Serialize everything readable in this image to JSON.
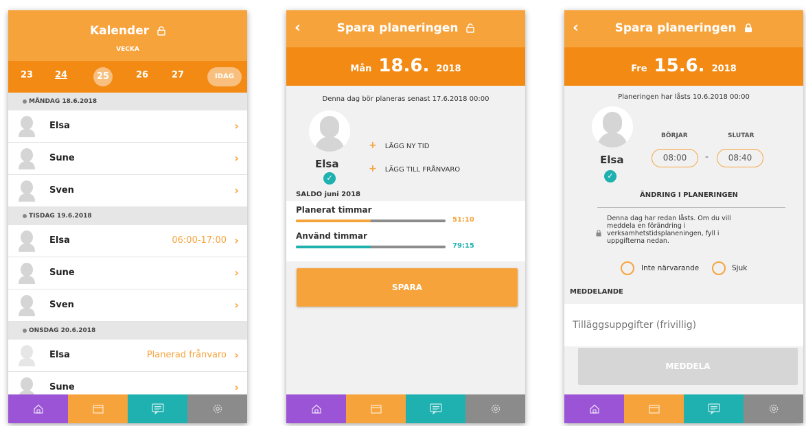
{
  "colors": {
    "accent": "#f7a33c",
    "accent_dark": "#f28a14",
    "teal": "#1fb1b0",
    "purple": "#9c54d6",
    "grey": "#8b8b8b"
  },
  "calendar": {
    "title": "Kalender",
    "subtitle": "VECKA",
    "weeks": [
      "23",
      "24",
      "25",
      "26",
      "27"
    ],
    "today_label": "IDAG",
    "days": [
      {
        "header": "MÅNDAG 18.6.2018",
        "rows": [
          {
            "name": "Elsa",
            "time": ""
          },
          {
            "name": "Sune",
            "time": ""
          },
          {
            "name": "Sven",
            "time": ""
          }
        ]
      },
      {
        "header": "TISDAG 19.6.2018",
        "rows": [
          {
            "name": "Elsa",
            "time": "06:00-17:00"
          },
          {
            "name": "Sune",
            "time": ""
          },
          {
            "name": "Sven",
            "time": ""
          }
        ]
      },
      {
        "header": "ONSDAG 20.6.2018",
        "rows": [
          {
            "name": "Elsa",
            "time": "Planerad frånvaro"
          },
          {
            "name": "Sune",
            "time": ""
          }
        ]
      }
    ]
  },
  "plan": {
    "title": "Spara planeringen",
    "day_name": "Mån",
    "date": "18.6.",
    "year": "2018",
    "info": "Denna dag bör planeras senast 17.6.2018 00:00",
    "person": "Elsa",
    "actions": [
      "LÄGG NY TID",
      "LÄGG TILL FRÅNVARO"
    ],
    "saldo_label": "SALDO juni 2018",
    "balances": [
      {
        "label": "Planerat timmar",
        "value": "51:10",
        "fraction": 0.5
      },
      {
        "label": "Använd timmar",
        "value": "79:15",
        "fraction": 0.5
      }
    ],
    "save_label": "SPARA"
  },
  "locked": {
    "title": "Spara planeringen",
    "day_name": "Fre",
    "date": "15.6.",
    "year": "2018",
    "info": "Planeringen har låsts 10.6.2018 00:00",
    "person": "Elsa",
    "start_label": "BÖRJAR",
    "end_label": "SLUTAR",
    "start_time": "08:00",
    "end_time": "08:40",
    "separator": "-",
    "change_label": "ÄNDRING I PLANERINGEN",
    "lock_message": "Denna dag har redan låsts. Om du vill meddela en förändring i verksamhetstidsplaneningen, fyll i uppgifterna nedan.",
    "radio_absent": "Inte närvarande",
    "radio_sick": "Sjuk",
    "message_label": "MEDDELANDE",
    "message_placeholder": "Tilläggsuppgifter (frivillig)",
    "submit_label": "MEDDELA"
  },
  "icons": {
    "home": "home-icon",
    "calendar": "calendar-icon",
    "chat": "chat-icon",
    "settings": "gear-icon",
    "back": "back-icon",
    "lock": "lock-icon"
  }
}
